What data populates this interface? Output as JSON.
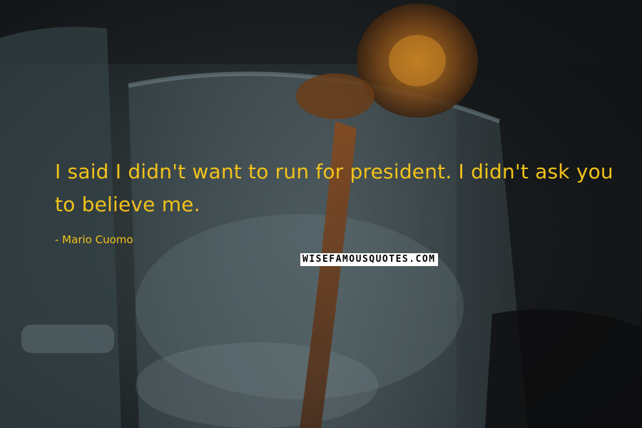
{
  "quote": {
    "text": "I said I didn't want to run for president. I didn't ask you to believe me.",
    "author": "- Mario Cuomo",
    "color": "#f2c21a"
  },
  "watermark": {
    "text": "WISEFAMOUSQUOTES.COM"
  }
}
